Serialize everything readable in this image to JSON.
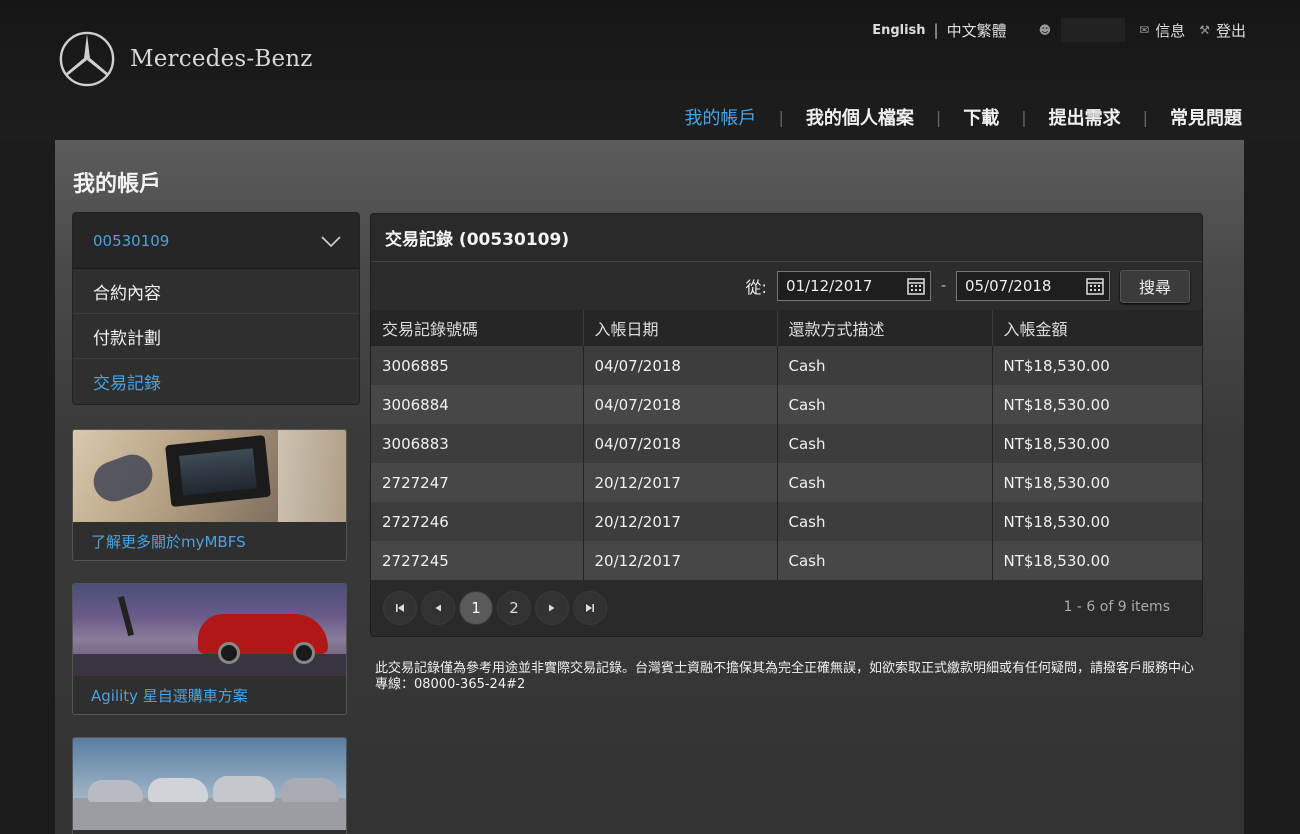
{
  "header": {
    "brand": "Mercedes-Benz",
    "lang_en": "English",
    "lang_sep": "|",
    "lang_zh": "中文繁體",
    "messages_label": "信息",
    "logout_label": "登出"
  },
  "nav": {
    "items": [
      "我的帳戶",
      "我的個人檔案",
      "下載",
      "提出需求",
      "常見問題"
    ],
    "separator": "|",
    "active": "我的帳戶"
  },
  "page": {
    "title": "我的帳戶"
  },
  "account_menu": {
    "selected_account": "00530109",
    "items": [
      "合約內容",
      "付款計劃",
      "交易記錄"
    ],
    "active": "交易記錄"
  },
  "promos": [
    {
      "caption": "了解更多關於myMBFS"
    },
    {
      "caption": "Agility 星自選購車方案"
    },
    {
      "caption": ""
    }
  ],
  "transactions": {
    "title": "交易記錄 (00530109)",
    "filter": {
      "from_label": "從:",
      "from_date": "01/12/2017",
      "separator": "-",
      "to_date": "05/07/2018",
      "search_label": "搜尋"
    },
    "columns": [
      "交易記錄號碼",
      "入帳日期",
      "還款方式描述",
      "入帳金額"
    ],
    "rows": [
      [
        "3006885",
        "04/07/2018",
        "Cash",
        "NT$18,530.00"
      ],
      [
        "3006884",
        "04/07/2018",
        "Cash",
        "NT$18,530.00"
      ],
      [
        "3006883",
        "04/07/2018",
        "Cash",
        "NT$18,530.00"
      ],
      [
        "2727247",
        "20/12/2017",
        "Cash",
        "NT$18,530.00"
      ],
      [
        "2727246",
        "20/12/2017",
        "Cash",
        "NT$18,530.00"
      ],
      [
        "2727245",
        "20/12/2017",
        "Cash",
        "NT$18,530.00"
      ]
    ],
    "pager": {
      "first_icon": "first-page-icon",
      "prev_icon": "prev-page-icon",
      "pages": [
        "1",
        "2"
      ],
      "current_page": "1",
      "next_icon": "next-page-icon",
      "last_icon": "last-page-icon",
      "info": "1 - 6 of 9 items"
    }
  },
  "disclaimer": "此交易記錄僅為參考用途並非實際交易記錄。台灣賓士資融不擔保其為完全正確無誤，如欲索取正式繳款明細或有任何疑問，請撥客戶服務中心專線：08000-365-24#2",
  "colors": {
    "accent": "#4aa3df",
    "background": "#1c1c1c",
    "panel": "#4a4a4a",
    "row_odd": "#3d3d3d",
    "row_even": "#474747"
  }
}
